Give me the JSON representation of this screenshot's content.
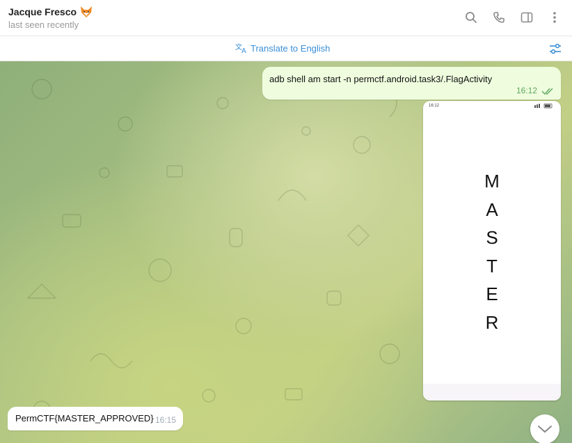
{
  "header": {
    "contact_name": "Jacque Fresco",
    "status": "last seen recently",
    "icons": [
      "search-icon",
      "phone-icon",
      "sidebar-icon",
      "more-icon"
    ]
  },
  "translate_bar": {
    "label": "Translate to English"
  },
  "messages": [
    {
      "direction": "outgoing",
      "text": "adb shell am start  -n permctf.android.task3/.FlagActivity",
      "time": "16:12",
      "read": true
    },
    {
      "direction": "outgoing",
      "type": "image",
      "screenshot": {
        "status_time": "16:12",
        "letters": [
          "M",
          "A",
          "S",
          "T",
          "E",
          "R"
        ]
      }
    },
    {
      "direction": "incoming",
      "text": "PermCTF{MASTER_APPROVED}",
      "time": "16:15"
    }
  ],
  "colors": {
    "accent": "#3a8fd6",
    "outgoing_bubble": "#effdde",
    "outgoing_time": "#5fa761"
  }
}
